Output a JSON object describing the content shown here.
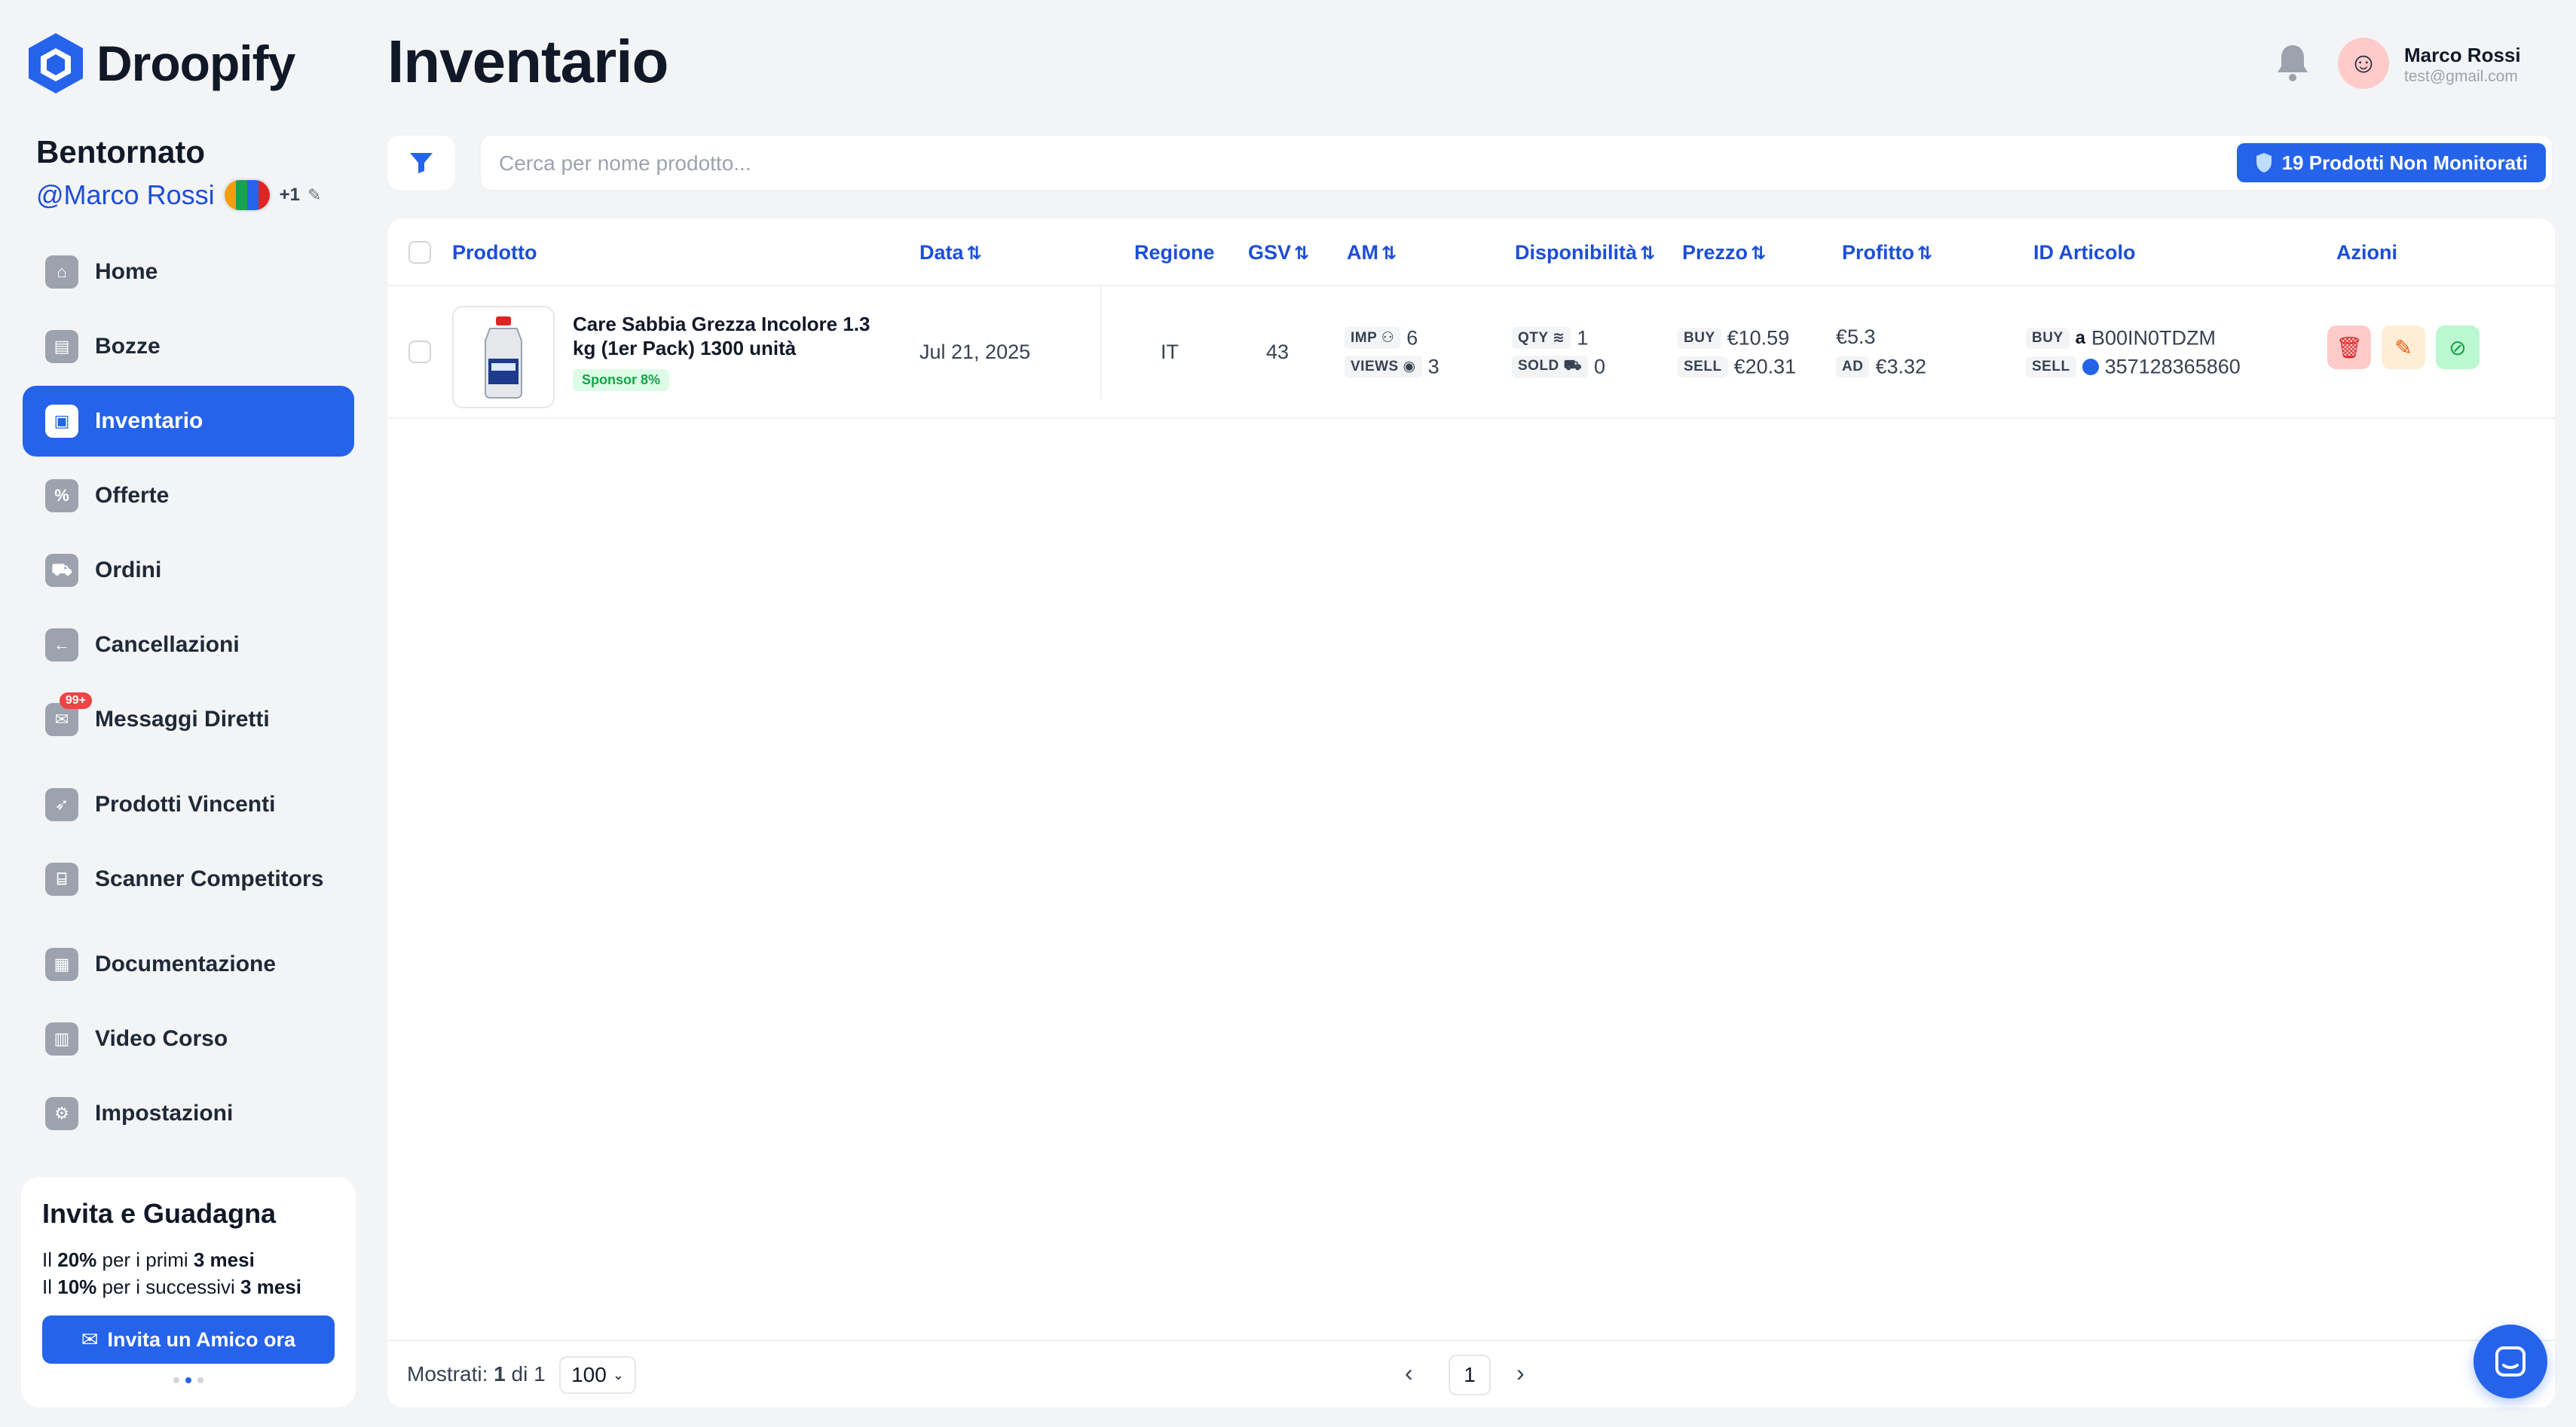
{
  "app": {
    "name": "Droopify"
  },
  "sidebar": {
    "welcome": "Bentornato",
    "handle": "@Marco Rossi",
    "plus": "+1",
    "items": [
      {
        "label": "Home",
        "icon": "home-icon"
      },
      {
        "label": "Bozze",
        "icon": "drafts-icon"
      },
      {
        "label": "Inventario",
        "icon": "inventory-icon",
        "active": true
      },
      {
        "label": "Offerte",
        "icon": "offers-icon"
      },
      {
        "label": "Ordini",
        "icon": "cart-icon"
      },
      {
        "label": "Cancellazioni",
        "icon": "cancel-arrow-icon"
      },
      {
        "label": "Messaggi Diretti",
        "icon": "message-icon",
        "badge": "99+"
      },
      {
        "label": "Prodotti Vincenti",
        "icon": "rocket-icon"
      },
      {
        "label": "Scanner Competitors",
        "icon": "scanner-icon"
      },
      {
        "label": "Documentazione",
        "icon": "document-icon"
      },
      {
        "label": "Video Corso",
        "icon": "book-icon"
      },
      {
        "label": "Impostazioni",
        "icon": "gear-icon"
      }
    ]
  },
  "invite": {
    "title": "Invita e Guadagna",
    "line1_prefix": "Il ",
    "line1_bold": "20%",
    "line1_mid": " per i primi ",
    "line1_bold2": "3 mesi",
    "line2_prefix": "Il ",
    "line2_bold": "10%",
    "line2_mid": " per i successivi ",
    "line2_bold2": "3 mesi",
    "button": "Invita un Amico ora"
  },
  "header": {
    "title": "Inventario",
    "user_name": "Marco Rossi",
    "user_email": "test@gmail.com"
  },
  "toolbar": {
    "search_placeholder": "Cerca per nome prodotto...",
    "unmonitored_button": "19 Prodotti Non Monitorati"
  },
  "table": {
    "columns": {
      "prodotto": "Prodotto",
      "data": "Data",
      "regione": "Regione",
      "gsv": "GSV",
      "am": "AM",
      "disponibilita": "Disponibilità",
      "prezzo": "Prezzo",
      "profitto": "Profitto",
      "id_articolo": "ID Articolo",
      "azioni": "Azioni"
    },
    "rows": [
      {
        "name": "Care Sabbia Grezza Incolore 1.3 kg (1er Pack) 1300 unità",
        "sponsor": "Sponsor 8%",
        "date": "Jul 21, 2025",
        "region": "IT",
        "gsv": "43",
        "imp_label": "IMP",
        "imp": "6",
        "views_label": "VIEWS",
        "views": "3",
        "qty_label": "QTY",
        "qty": "1",
        "sold_label": "SOLD",
        "sold": "0",
        "buy_label": "BUY",
        "buy_price": "€10.59",
        "sell_label": "SELL",
        "sell_price": "€20.31",
        "profit": "€5.3",
        "ad_label": "AD",
        "ad": "€3.32",
        "id_buy_label": "BUY",
        "id_buy": "B00IN0TDZM",
        "id_sell_label": "SELL",
        "id_sell": "357128365860"
      }
    ]
  },
  "footer": {
    "shown_label": "Mostrati:",
    "shown_from": "1",
    "shown_of": "di",
    "shown_total": "1",
    "per_page": "100",
    "current_page": "1"
  },
  "colors": {
    "accent": "#2563eb",
    "text": "#111827",
    "bg": "#f3f4f6"
  }
}
